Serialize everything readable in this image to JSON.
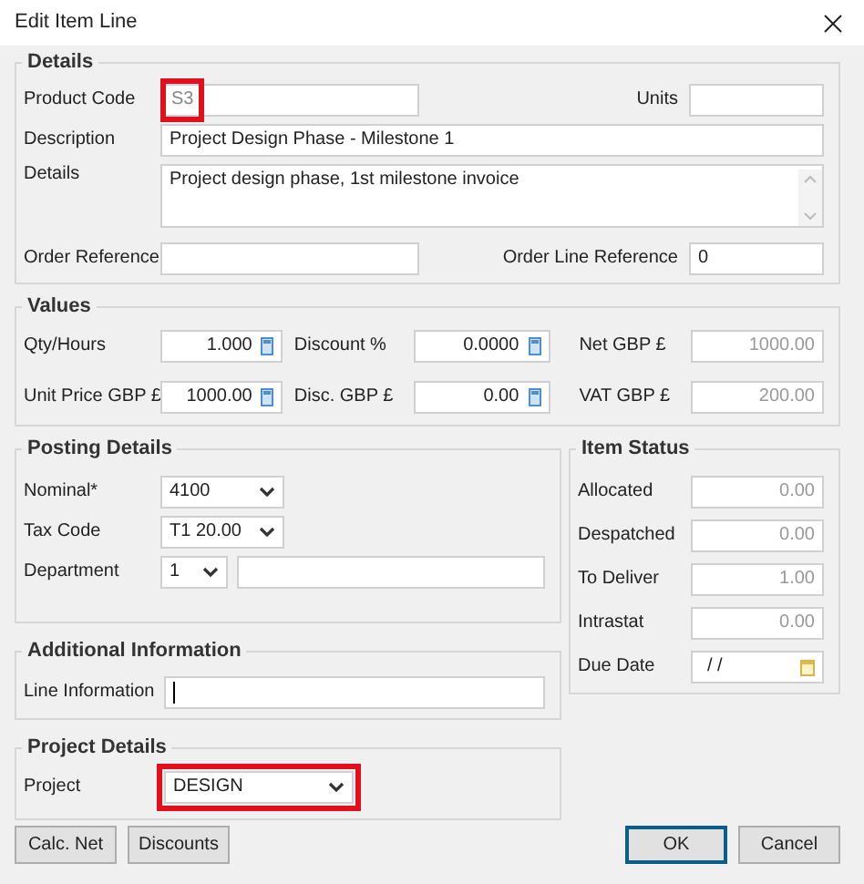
{
  "window": {
    "title": "Edit Item Line"
  },
  "details": {
    "legend": "Details",
    "product_code": {
      "label": "Product Code",
      "value": "S3",
      "highlighted": true
    },
    "units": {
      "label": "Units"
    },
    "description": {
      "label": "Description",
      "value": "Project Design Phase - Milestone 1"
    },
    "details_text": {
      "label": "Details",
      "value": "Project design phase, 1st milestone invoice"
    },
    "order_reference": {
      "label": "Order Reference"
    },
    "order_line_reference": {
      "label": "Order Line Reference",
      "value": "0"
    }
  },
  "values": {
    "legend": "Values",
    "fields": [
      {
        "label": "Qty/Hours",
        "value": "1.000",
        "kind": "spin"
      },
      {
        "label": "Discount %",
        "value": "0.0000",
        "kind": "spin"
      },
      {
        "label": "Net GBP £",
        "value": "1000.00",
        "kind": "readonly"
      },
      {
        "label": "Unit Price GBP £",
        "value": "1000.00",
        "kind": "spin"
      },
      {
        "label": "Disc. GBP £",
        "value": "0.00",
        "kind": "spin"
      },
      {
        "label": "VAT GBP £",
        "value": "200.00",
        "kind": "readonly"
      }
    ]
  },
  "posting_details": {
    "legend": "Posting Details",
    "nominal": {
      "label": "Nominal*",
      "value": "4100"
    },
    "tax_code": {
      "label": "Tax Code",
      "value": "T1  20.00"
    },
    "department": {
      "label": "Department",
      "value": "1"
    }
  },
  "item_status": {
    "legend": "Item Status",
    "fields": [
      {
        "label": "Allocated",
        "value": "0.00",
        "kind": "readonly"
      },
      {
        "label": "Despatched",
        "value": "0.00",
        "kind": "readonly"
      },
      {
        "label": "To Deliver",
        "value": "1.00",
        "kind": "readonly"
      },
      {
        "label": "Intrastat",
        "value": "0.00",
        "kind": "readonly"
      },
      {
        "label": "Due Date",
        "value": "/ /",
        "kind": "date"
      }
    ]
  },
  "additional_information": {
    "legend": "Additional Information",
    "line_information": {
      "label": "Line Information",
      "focused": true
    }
  },
  "project_details": {
    "legend": "Project Details",
    "project": {
      "label": "Project",
      "value": "DESIGN",
      "highlighted": true
    }
  },
  "left_buttons": [
    {
      "label": "Calc. Net",
      "default": false
    },
    {
      "label": "Discounts",
      "default": false
    }
  ],
  "right_buttons": [
    {
      "label": "OK",
      "default": true
    },
    {
      "label": "Cancel",
      "default": false
    }
  ]
}
